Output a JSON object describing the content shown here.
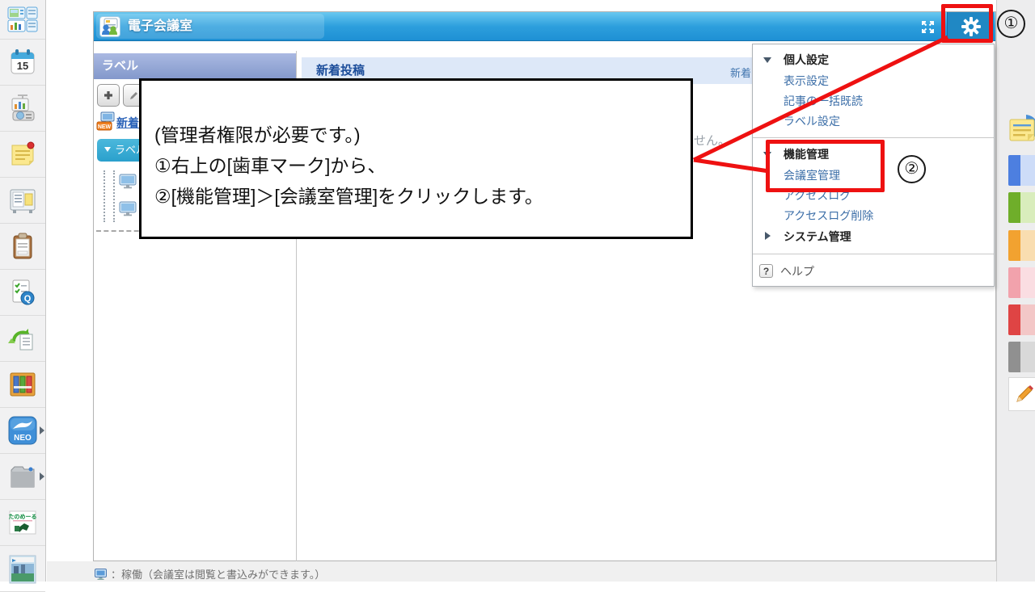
{
  "app": {
    "title": "電子会議室"
  },
  "sidebar": {
    "items": [
      {
        "name": "portal"
      },
      {
        "name": "schedule",
        "label": "15"
      },
      {
        "name": "facility-reservation"
      },
      {
        "name": "memo"
      },
      {
        "name": "bulletin-board"
      },
      {
        "name": "document"
      },
      {
        "name": "survey"
      },
      {
        "name": "workflow"
      },
      {
        "name": "cabinet"
      },
      {
        "name": "neo",
        "label": "NEO"
      },
      {
        "name": "folder"
      },
      {
        "name": "tanomail",
        "label": "たのめーる"
      },
      {
        "name": "banner"
      }
    ]
  },
  "label_panel": {
    "title": "ラベル",
    "new_badge": "NEW",
    "new_link": "新着",
    "tree_toggle_label": "ラベル"
  },
  "main": {
    "heading": "新着投稿",
    "heading_right_fragment": "新着",
    "empty_message_fragment": "せん。"
  },
  "settings_menu": {
    "items": [
      {
        "type": "section",
        "label": "個人設定",
        "expanded": true
      },
      {
        "type": "link",
        "label": "表示設定"
      },
      {
        "type": "link",
        "label": "記事の一括既読"
      },
      {
        "type": "link",
        "label": "ラベル設定"
      },
      {
        "type": "divider"
      },
      {
        "type": "section",
        "label": "機能管理",
        "expanded": true
      },
      {
        "type": "link",
        "label": "会議室管理"
      },
      {
        "type": "link",
        "label": "アクセスログ"
      },
      {
        "type": "link",
        "label": "アクセスログ削除"
      },
      {
        "type": "section",
        "label": "システム管理",
        "expanded": false
      },
      {
        "type": "divider"
      },
      {
        "type": "help",
        "label": "ヘルプ",
        "icon_label": "?"
      }
    ]
  },
  "annotation": {
    "note_lines": [
      "(管理者権限が必要です。)",
      "①右上の[歯車マーク]から、",
      "②[機能管理]＞[会議室管理]をクリックします。"
    ],
    "step1_marker": "①",
    "step2_marker": "②",
    "highlight_color": "#ee1111"
  },
  "legend": {
    "text": "：稼働（会議室は閲覧と書込みができます。）"
  },
  "colors": {
    "header_blue": "#2d9fdd",
    "menu_link_blue": "#3d6fa8",
    "accent_red": "#ee1111",
    "label_header": "#8398cb",
    "band_blue": "#dde8f8"
  }
}
